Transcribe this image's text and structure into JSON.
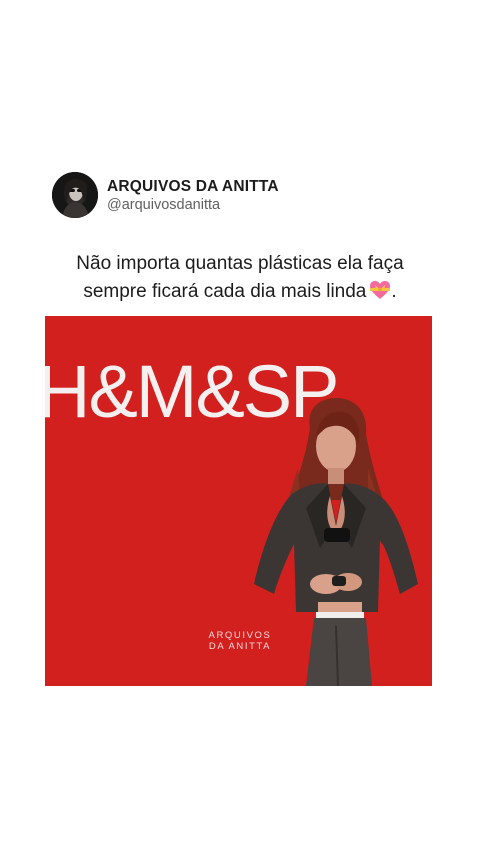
{
  "post": {
    "author": {
      "display_name": "ARQUIVOS DA ANITTA",
      "handle": "@arquivosdanitta"
    },
    "text_line1": "Não importa quantas plásticas ela faça",
    "text_line2": "sempre ficará cada dia mais linda",
    "text_end": ".",
    "emoji": "heart-with-ribbon-icon"
  },
  "media": {
    "backdrop_text": "H&M&SP",
    "watermark_line1": "ARQUIVOS",
    "watermark_line2": "DA ANITTA",
    "background_color": "#d2201f"
  }
}
